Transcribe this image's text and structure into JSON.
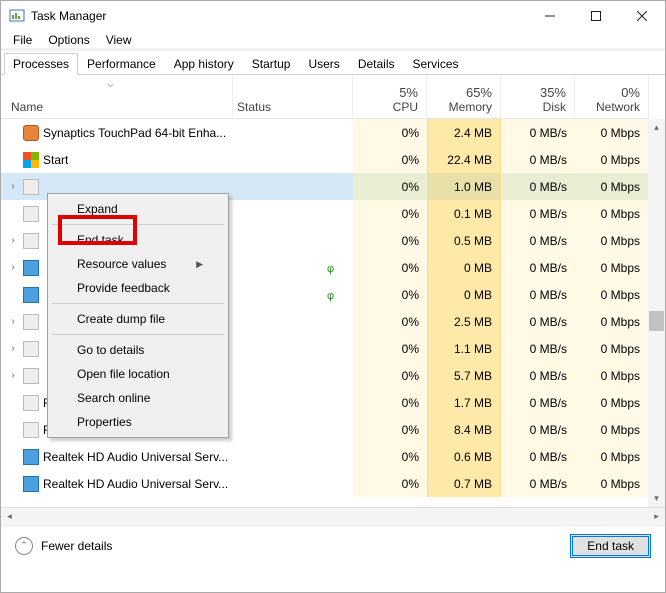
{
  "window": {
    "title": "Task Manager",
    "min": "Minimize",
    "max": "Maximize",
    "close": "Close"
  },
  "menu": {
    "file": "File",
    "options": "Options",
    "view": "View"
  },
  "tabs": [
    "Processes",
    "Performance",
    "App history",
    "Startup",
    "Users",
    "Details",
    "Services"
  ],
  "active_tab": 0,
  "columns": {
    "name": "Name",
    "status": "Status",
    "cpu": {
      "pct": "5%",
      "label": "CPU"
    },
    "memory": {
      "pct": "65%",
      "label": "Memory"
    },
    "disk": {
      "pct": "35%",
      "label": "Disk"
    },
    "network": {
      "pct": "0%",
      "label": "Network"
    }
  },
  "rows": [
    {
      "exp": false,
      "icon": "orange",
      "name": "Synaptics TouchPad 64-bit Enha...",
      "cpu": "0%",
      "mem": "2.4 MB",
      "disk": "0 MB/s",
      "net": "0 Mbps"
    },
    {
      "exp": false,
      "icon": "winlogo",
      "name": "Start",
      "cpu": "0%",
      "mem": "22.4 MB",
      "disk": "0 MB/s",
      "net": "0 Mbps"
    },
    {
      "exp": true,
      "icon": "generic",
      "name": "",
      "selected": true,
      "cpu": "0%",
      "mem": "1.0 MB",
      "disk": "0 MB/s",
      "net": "0 Mbps"
    },
    {
      "exp": false,
      "icon": "generic",
      "name": "",
      "cpu": "0%",
      "mem": "0.1 MB",
      "disk": "0 MB/s",
      "net": "0 Mbps"
    },
    {
      "exp": true,
      "icon": "generic",
      "name": "",
      "cpu": "0%",
      "mem": "0.5 MB",
      "disk": "0 MB/s",
      "net": "0 Mbps"
    },
    {
      "exp": true,
      "icon": "bluebox",
      "name": "",
      "leaf": true,
      "cpu": "0%",
      "mem": "0 MB",
      "disk": "0 MB/s",
      "net": "0 Mbps"
    },
    {
      "exp": false,
      "icon": "bluebox",
      "name": "",
      "leaf": true,
      "cpu": "0%",
      "mem": "0 MB",
      "disk": "0 MB/s",
      "net": "0 Mbps"
    },
    {
      "exp": true,
      "icon": "generic",
      "name": "",
      "cpu": "0%",
      "mem": "2.5 MB",
      "disk": "0 MB/s",
      "net": "0 Mbps"
    },
    {
      "exp": true,
      "icon": "generic",
      "name": "",
      "cpu": "0%",
      "mem": "1.1 MB",
      "disk": "0 MB/s",
      "net": "0 Mbps"
    },
    {
      "exp": true,
      "icon": "generic",
      "name": "",
      "cpu": "0%",
      "mem": "5.7 MB",
      "disk": "0 MB/s",
      "net": "0 Mbps"
    },
    {
      "exp": false,
      "icon": "generic",
      "name": "Runtime Broker",
      "cpu": "0%",
      "mem": "1.7 MB",
      "disk": "0 MB/s",
      "net": "0 Mbps"
    },
    {
      "exp": false,
      "icon": "generic",
      "name": "Runtime Broker",
      "cpu": "0%",
      "mem": "8.4 MB",
      "disk": "0 MB/s",
      "net": "0 Mbps"
    },
    {
      "exp": false,
      "icon": "bluebox",
      "name": "Realtek HD Audio Universal Serv...",
      "cpu": "0%",
      "mem": "0.6 MB",
      "disk": "0 MB/s",
      "net": "0 Mbps"
    },
    {
      "exp": false,
      "icon": "bluebox",
      "name": "Realtek HD Audio Universal Serv...",
      "cpu": "0%",
      "mem": "0.7 MB",
      "disk": "0 MB/s",
      "net": "0 Mbps"
    }
  ],
  "context_menu": {
    "expand": "Expand",
    "end_task": "End task",
    "resource_values": "Resource values",
    "provide_feedback": "Provide feedback",
    "create_dump": "Create dump file",
    "go_details": "Go to details",
    "open_location": "Open file location",
    "search_online": "Search online",
    "properties": "Properties"
  },
  "footer": {
    "fewer": "Fewer details",
    "end_task": "End task"
  }
}
